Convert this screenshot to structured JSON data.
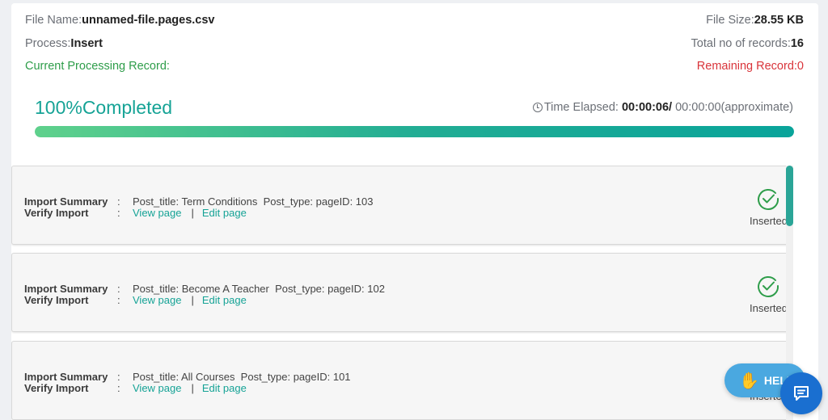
{
  "file": {
    "name_label": "File Name:",
    "name_value": "unnamed-file.pages.csv",
    "size_label": "File Size:",
    "size_value": "28.55 KB"
  },
  "process": {
    "label": "Process:",
    "value": "Insert",
    "total_label": "Total no of records:",
    "total_value": "16"
  },
  "processing": {
    "current_label": "Current Processing Record:",
    "remaining_label": "Remaining Record:",
    "remaining_value": "0"
  },
  "progress": {
    "title": "100%Completed",
    "fraction": 1.0,
    "time_label": "Time Elapsed:",
    "elapsed": "00:00:06/",
    "approx": "00:00:00(approximate)"
  },
  "records": [
    {
      "summary_label": "Import Summary",
      "verify_label": "Verify Import",
      "colon": ":",
      "detail": "Post_title: Term Conditions  Post_type: pageID: 103",
      "view_link": "View page",
      "separator": "|",
      "edit_link": "Edit page",
      "status": "Inserted"
    },
    {
      "summary_label": "Import Summary",
      "verify_label": "Verify Import",
      "colon": ":",
      "detail": "Post_title: Become A Teacher  Post_type: pageID: 102",
      "view_link": "View page",
      "separator": "|",
      "edit_link": "Edit page",
      "status": "Inserted"
    },
    {
      "summary_label": "Import Summary",
      "verify_label": "Verify Import",
      "colon": ":",
      "detail": "Post_title: All Courses  Post_type: pageID: 101",
      "view_link": "View page",
      "separator": "|",
      "edit_link": "Edit page",
      "status": "Inserted"
    }
  ],
  "help": {
    "label": "HELP"
  },
  "colors": {
    "accent": "#16a396",
    "success": "#2e9d4a",
    "danger": "#d9343a",
    "help": "#4aa8e0",
    "chat": "#1a6fd0"
  },
  "icons": {
    "clock": "clock-icon",
    "status": "check-circle-icon",
    "help": "hand-icon",
    "chat": "chat-icon"
  }
}
